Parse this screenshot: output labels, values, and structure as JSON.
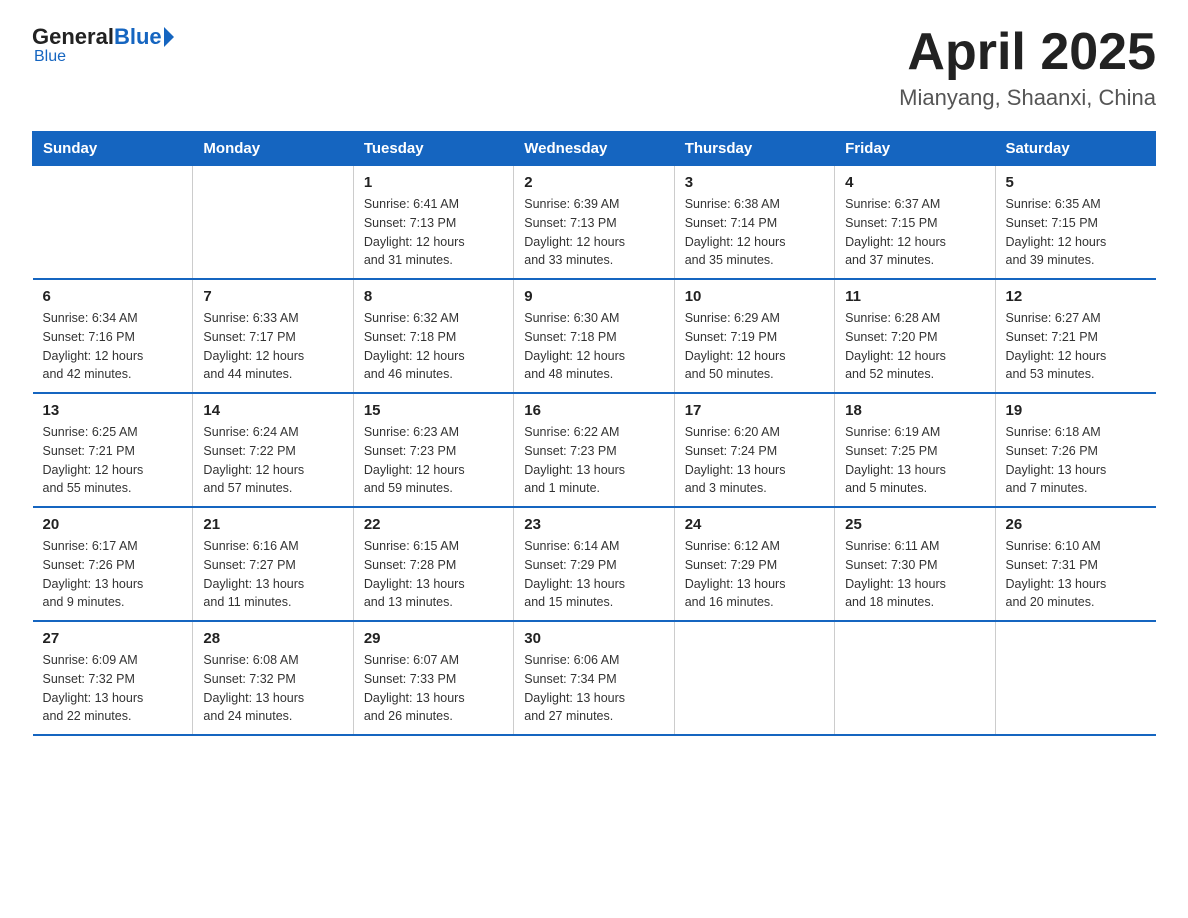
{
  "header": {
    "logo_general": "General",
    "logo_blue": "Blue",
    "title": "April 2025",
    "subtitle": "Mianyang, Shaanxi, China"
  },
  "weekdays": [
    "Sunday",
    "Monday",
    "Tuesday",
    "Wednesday",
    "Thursday",
    "Friday",
    "Saturday"
  ],
  "weeks": [
    [
      {
        "day": "",
        "info": ""
      },
      {
        "day": "",
        "info": ""
      },
      {
        "day": "1",
        "info": "Sunrise: 6:41 AM\nSunset: 7:13 PM\nDaylight: 12 hours\nand 31 minutes."
      },
      {
        "day": "2",
        "info": "Sunrise: 6:39 AM\nSunset: 7:13 PM\nDaylight: 12 hours\nand 33 minutes."
      },
      {
        "day": "3",
        "info": "Sunrise: 6:38 AM\nSunset: 7:14 PM\nDaylight: 12 hours\nand 35 minutes."
      },
      {
        "day": "4",
        "info": "Sunrise: 6:37 AM\nSunset: 7:15 PM\nDaylight: 12 hours\nand 37 minutes."
      },
      {
        "day": "5",
        "info": "Sunrise: 6:35 AM\nSunset: 7:15 PM\nDaylight: 12 hours\nand 39 minutes."
      }
    ],
    [
      {
        "day": "6",
        "info": "Sunrise: 6:34 AM\nSunset: 7:16 PM\nDaylight: 12 hours\nand 42 minutes."
      },
      {
        "day": "7",
        "info": "Sunrise: 6:33 AM\nSunset: 7:17 PM\nDaylight: 12 hours\nand 44 minutes."
      },
      {
        "day": "8",
        "info": "Sunrise: 6:32 AM\nSunset: 7:18 PM\nDaylight: 12 hours\nand 46 minutes."
      },
      {
        "day": "9",
        "info": "Sunrise: 6:30 AM\nSunset: 7:18 PM\nDaylight: 12 hours\nand 48 minutes."
      },
      {
        "day": "10",
        "info": "Sunrise: 6:29 AM\nSunset: 7:19 PM\nDaylight: 12 hours\nand 50 minutes."
      },
      {
        "day": "11",
        "info": "Sunrise: 6:28 AM\nSunset: 7:20 PM\nDaylight: 12 hours\nand 52 minutes."
      },
      {
        "day": "12",
        "info": "Sunrise: 6:27 AM\nSunset: 7:21 PM\nDaylight: 12 hours\nand 53 minutes."
      }
    ],
    [
      {
        "day": "13",
        "info": "Sunrise: 6:25 AM\nSunset: 7:21 PM\nDaylight: 12 hours\nand 55 minutes."
      },
      {
        "day": "14",
        "info": "Sunrise: 6:24 AM\nSunset: 7:22 PM\nDaylight: 12 hours\nand 57 minutes."
      },
      {
        "day": "15",
        "info": "Sunrise: 6:23 AM\nSunset: 7:23 PM\nDaylight: 12 hours\nand 59 minutes."
      },
      {
        "day": "16",
        "info": "Sunrise: 6:22 AM\nSunset: 7:23 PM\nDaylight: 13 hours\nand 1 minute."
      },
      {
        "day": "17",
        "info": "Sunrise: 6:20 AM\nSunset: 7:24 PM\nDaylight: 13 hours\nand 3 minutes."
      },
      {
        "day": "18",
        "info": "Sunrise: 6:19 AM\nSunset: 7:25 PM\nDaylight: 13 hours\nand 5 minutes."
      },
      {
        "day": "19",
        "info": "Sunrise: 6:18 AM\nSunset: 7:26 PM\nDaylight: 13 hours\nand 7 minutes."
      }
    ],
    [
      {
        "day": "20",
        "info": "Sunrise: 6:17 AM\nSunset: 7:26 PM\nDaylight: 13 hours\nand 9 minutes."
      },
      {
        "day": "21",
        "info": "Sunrise: 6:16 AM\nSunset: 7:27 PM\nDaylight: 13 hours\nand 11 minutes."
      },
      {
        "day": "22",
        "info": "Sunrise: 6:15 AM\nSunset: 7:28 PM\nDaylight: 13 hours\nand 13 minutes."
      },
      {
        "day": "23",
        "info": "Sunrise: 6:14 AM\nSunset: 7:29 PM\nDaylight: 13 hours\nand 15 minutes."
      },
      {
        "day": "24",
        "info": "Sunrise: 6:12 AM\nSunset: 7:29 PM\nDaylight: 13 hours\nand 16 minutes."
      },
      {
        "day": "25",
        "info": "Sunrise: 6:11 AM\nSunset: 7:30 PM\nDaylight: 13 hours\nand 18 minutes."
      },
      {
        "day": "26",
        "info": "Sunrise: 6:10 AM\nSunset: 7:31 PM\nDaylight: 13 hours\nand 20 minutes."
      }
    ],
    [
      {
        "day": "27",
        "info": "Sunrise: 6:09 AM\nSunset: 7:32 PM\nDaylight: 13 hours\nand 22 minutes."
      },
      {
        "day": "28",
        "info": "Sunrise: 6:08 AM\nSunset: 7:32 PM\nDaylight: 13 hours\nand 24 minutes."
      },
      {
        "day": "29",
        "info": "Sunrise: 6:07 AM\nSunset: 7:33 PM\nDaylight: 13 hours\nand 26 minutes."
      },
      {
        "day": "30",
        "info": "Sunrise: 6:06 AM\nSunset: 7:34 PM\nDaylight: 13 hours\nand 27 minutes."
      },
      {
        "day": "",
        "info": ""
      },
      {
        "day": "",
        "info": ""
      },
      {
        "day": "",
        "info": ""
      }
    ]
  ]
}
